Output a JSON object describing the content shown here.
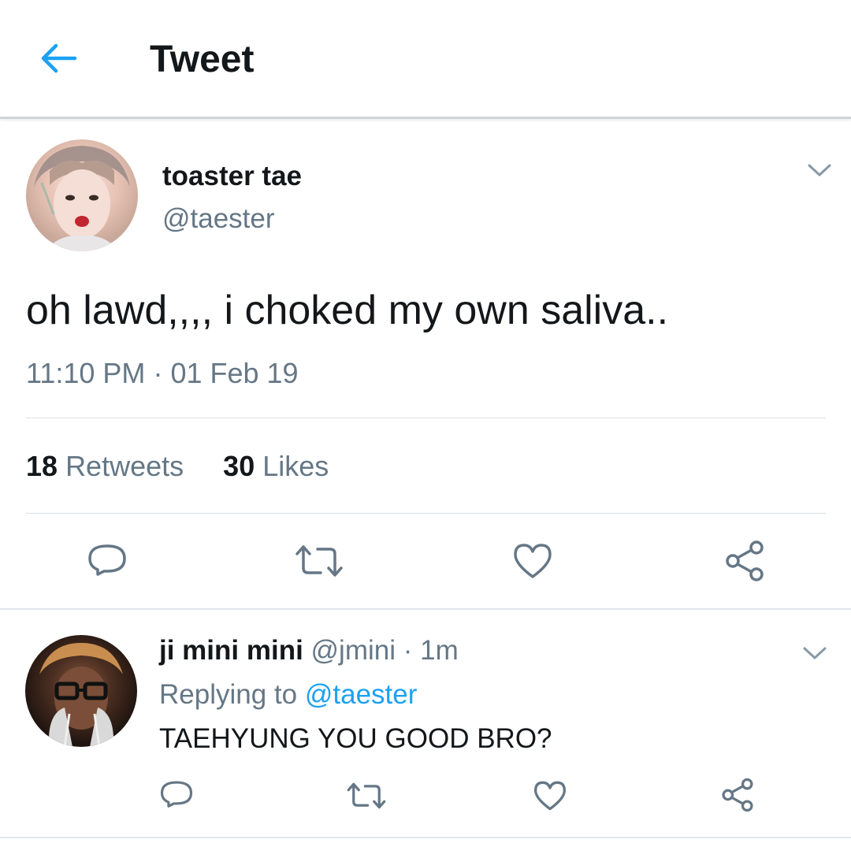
{
  "header": {
    "title": "Tweet",
    "back_icon": "arrow-left-icon",
    "accent_color": "#1da1f2"
  },
  "tweet": {
    "author_name": "toaster tae",
    "author_handle": "@taester",
    "text": "oh lawd,,,, i choked my own saliva..",
    "time": "11:10 PM",
    "separator": "·",
    "date": "01 Feb 19",
    "retweets_count": "18",
    "retweets_label": "Retweets",
    "likes_count": "30",
    "likes_label": "Likes",
    "actions": [
      "reply-icon",
      "retweet-icon",
      "like-icon",
      "share-icon"
    ]
  },
  "reply": {
    "author_name": "ji mini mini",
    "author_handle": "@jmini",
    "separator": "·",
    "time": "1m",
    "replying_prefix": "Replying to",
    "replying_to": "@taester",
    "text": "TAEHYUNG YOU GOOD BRO?",
    "actions": [
      "reply-icon",
      "retweet-icon",
      "like-icon",
      "share-icon"
    ]
  },
  "colors": {
    "text_primary": "#14171a",
    "text_secondary": "#657786",
    "link": "#1da1f2",
    "icon": "#657786",
    "divider": "#d9dee2"
  }
}
